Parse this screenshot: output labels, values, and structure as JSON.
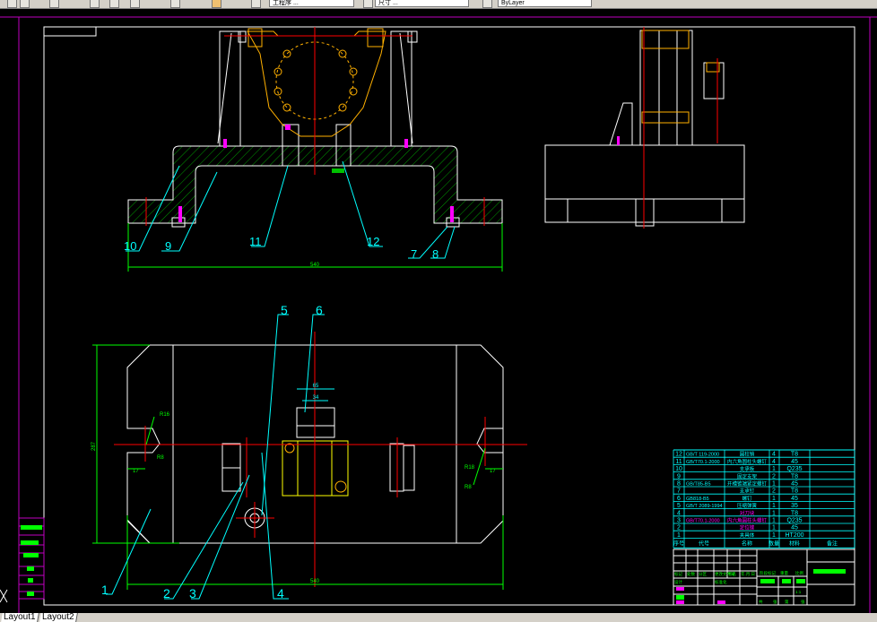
{
  "toolbar": {
    "layer_combo": "工程序 ...",
    "dimstyle_combo": "尺寸 ...",
    "linetype_combo": "ByLayer"
  },
  "tabs": [
    {
      "label": "Layout1"
    },
    {
      "label": "Layout2"
    }
  ],
  "colors": {
    "background": "#000000",
    "frame": "#ffffff",
    "layout_border": "#c000c0",
    "dimension": "#00ff00",
    "leader": "#00ffff",
    "centerline": "#ff0000",
    "fixture": "#ffb000",
    "hatch": "#00c000"
  },
  "drawing": {
    "front_view": {
      "labels": [
        "10",
        "9",
        "11",
        "12",
        "7",
        "8"
      ],
      "dimension": "540"
    },
    "top_view": {
      "labels": [
        "5",
        "6",
        "1",
        "2",
        "3",
        "4"
      ],
      "dimensions": {
        "width": "540",
        "height": "287",
        "slot_left": "17",
        "slot_right": "17",
        "r_left": "R16",
        "r_left2": "R8",
        "r_right": "R18",
        "r_right2": "R8",
        "key_w": "65",
        "key_w2": "34"
      }
    }
  },
  "bom": {
    "headers": [
      "序号",
      "代号",
      "名称",
      "数量",
      "材料",
      "备注"
    ],
    "rows": [
      {
        "no": "12",
        "code": "GB/T 119-2000",
        "name": "圆柱销",
        "qty": "4",
        "material": "T8"
      },
      {
        "no": "11",
        "code": "GB/T70.1-2000",
        "name": "内六角圆柱头螺钉",
        "qty": "4",
        "material": "45"
      },
      {
        "no": "10",
        "code": "",
        "name": "支承板",
        "qty": "1",
        "material": "Q235"
      },
      {
        "no": "9",
        "code": "",
        "name": "固定支架",
        "qty": "2",
        "material": "T8"
      },
      {
        "no": "8",
        "code": "GB/T85-B5",
        "name": "开槽锥端紧定螺钉",
        "qty": "1",
        "material": "45"
      },
      {
        "no": "7",
        "code": "",
        "name": "支承钉",
        "qty": "2",
        "material": "T8"
      },
      {
        "no": "6",
        "code": "GB818-B5",
        "name": "螺钉",
        "qty": "1",
        "material": "45"
      },
      {
        "no": "5",
        "code": "GB/T 2089-1994",
        "name": "压缩弹簧",
        "qty": "1",
        "material": "35"
      },
      {
        "no": "4",
        "code": "",
        "name": "对刀块",
        "qty": "1",
        "material": "T8"
      },
      {
        "no": "3",
        "code": "GB/T70.1-2000",
        "name": "内六角圆柱头螺钉",
        "qty": "1",
        "material": "Q235"
      },
      {
        "no": "2",
        "code": "",
        "name": "定位键",
        "qty": "1",
        "material": "45"
      },
      {
        "no": "1",
        "code": "",
        "name": "夹具体",
        "qty": "1",
        "material": "HT200"
      }
    ],
    "highlight_rows": [
      "4",
      "3",
      "2"
    ],
    "highlight_color": "#ff00ff"
  },
  "title_block": {
    "labels": [
      "标记",
      "处数",
      "分区",
      "更改文件号",
      "签名",
      "年.月.日",
      "设计",
      "标准化",
      "阶段标记",
      "重量",
      "比例",
      "1:1",
      "共",
      "张",
      "第",
      "张"
    ]
  }
}
